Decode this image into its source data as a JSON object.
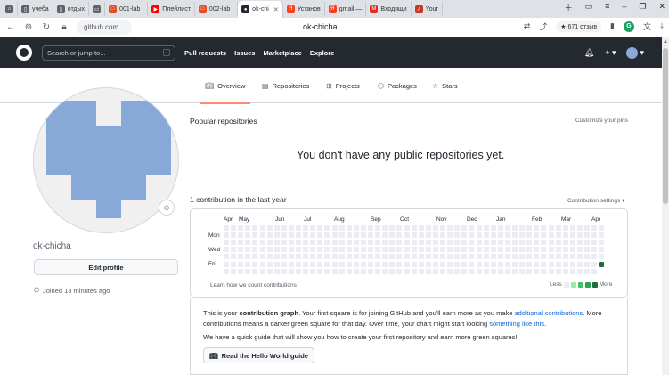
{
  "browser": {
    "tabs": [
      {
        "label": "",
        "icon": "home-icon",
        "color": "#5f6368"
      },
      {
        "label": "учеба",
        "icon": "bookmark-icon",
        "color": "#5f6368"
      },
      {
        "label": "отдых",
        "icon": "bookmark-icon",
        "color": "#5f6368"
      },
      {
        "label": "",
        "icon": "folder-icon",
        "color": "#5f6368"
      },
      {
        "label": "001-lab_",
        "icon": "page-icon",
        "color": "#e34c26"
      },
      {
        "label": "Плейлист",
        "icon": "youtube-icon",
        "color": "#ff0000"
      },
      {
        "label": "002-lab_",
        "icon": "page-icon",
        "color": "#e34c26"
      },
      {
        "label": "ok-chi",
        "icon": "github-icon",
        "color": "#24292f",
        "active": true
      },
      {
        "label": "Установ",
        "icon": "yandex-icon",
        "color": "#fc3f1d"
      },
      {
        "label": "gmail — ",
        "icon": "yandex-icon",
        "color": "#fc3f1d"
      },
      {
        "label": "Входящи",
        "icon": "gmail-icon",
        "color": "#d93025"
      },
      {
        "label": "Your",
        "icon": "arrow-icon",
        "color": "#c0392b"
      }
    ],
    "url": "github.com",
    "page_title": "ok-chicha",
    "rating": "★ 671 отзыв"
  },
  "header": {
    "search_placeholder": "Search or jump to...",
    "search_key": "/",
    "nav": [
      "Pull requests",
      "Issues",
      "Marketplace",
      "Explore"
    ]
  },
  "tabs": [
    {
      "label": "Overview",
      "icon": "book-icon",
      "active": true
    },
    {
      "label": "Repositories",
      "icon": "repo-icon"
    },
    {
      "label": "Projects",
      "icon": "table-icon"
    },
    {
      "label": "Packages",
      "icon": "package-icon"
    },
    {
      "label": "Stars",
      "icon": "star-icon"
    }
  ],
  "profile": {
    "username": "ok-chicha",
    "edit_button": "Edit profile",
    "joined": "Joined 13 minutes ago",
    "identicon_color": "#88a8d8"
  },
  "main": {
    "popular_title": "Popular repositories",
    "customize": "Customize your pins",
    "no_repos": "You don't have any public repositories yet.",
    "contrib_title": "1 contribution in the last year",
    "contrib_settings": "Contribution settings ▾"
  },
  "graph": {
    "months": [
      "Apr",
      "May",
      "Jun",
      "Jul",
      "Aug",
      "Sep",
      "Oct",
      "Nov",
      "Dec",
      "Jan",
      "Feb",
      "Mar",
      "Apr"
    ],
    "days": [
      "Mon",
      "Wed",
      "Fri"
    ],
    "contributions": 1,
    "learn": "Learn how we count contributions",
    "legend_less": "Less",
    "legend_more": "More",
    "legend_colors": [
      "#ebedf0",
      "#9be9a8",
      "#40c463",
      "#30a14e",
      "#216e39"
    ]
  },
  "info": {
    "p1_a": "This is your ",
    "p1_bold": "contribution graph",
    "p1_b": ". Your first square is for joining GitHub and you'll earn more as you make ",
    "p1_link1": "additional contributions",
    "p1_c": ". More contributions means a darker green square for that day. Over time, your chart might start looking ",
    "p1_link2": "something like this",
    "p1_d": ".",
    "p2": "We have a quick guide that will show you how to create your first repository and earn more green squares!",
    "button": "Read the Hello World guide"
  }
}
